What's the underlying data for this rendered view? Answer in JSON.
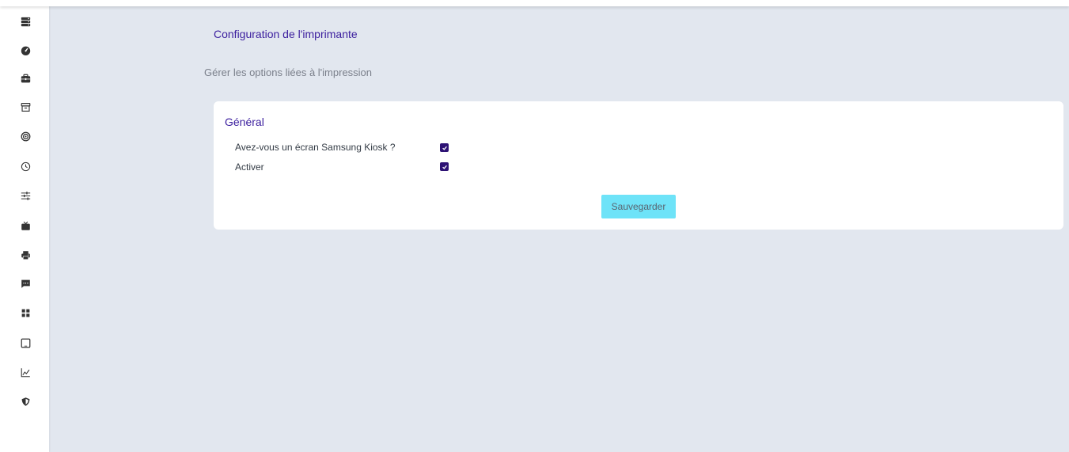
{
  "sidebar": {
    "items": [
      {
        "icon": "server-icon"
      },
      {
        "icon": "dashboard-icon"
      },
      {
        "icon": "briefcase-icon"
      },
      {
        "icon": "archive-icon"
      },
      {
        "icon": "target-icon"
      },
      {
        "icon": "clock-icon"
      },
      {
        "icon": "sliders-icon"
      },
      {
        "icon": "tv-icon"
      },
      {
        "icon": "printer-icon"
      },
      {
        "icon": "message-icon"
      },
      {
        "icon": "apps-icon"
      },
      {
        "icon": "tablet-icon"
      },
      {
        "icon": "chart-icon"
      },
      {
        "icon": "shield-icon"
      }
    ]
  },
  "header": {
    "title": "Configuration de l'imprimante",
    "subtitle": "Gérer les options liées à l'impression"
  },
  "card": {
    "title": "Général",
    "options": [
      {
        "label": "Avez-vous un écran Samsung Kiosk ?",
        "checked": true
      },
      {
        "label": "Activer",
        "checked": true
      }
    ],
    "save_label": "Sauvegarder"
  },
  "colors": {
    "accent": "#3b1e9e",
    "checkbox": "#2d1274",
    "button": "#6ee3f8",
    "background": "#e2e7ef"
  }
}
